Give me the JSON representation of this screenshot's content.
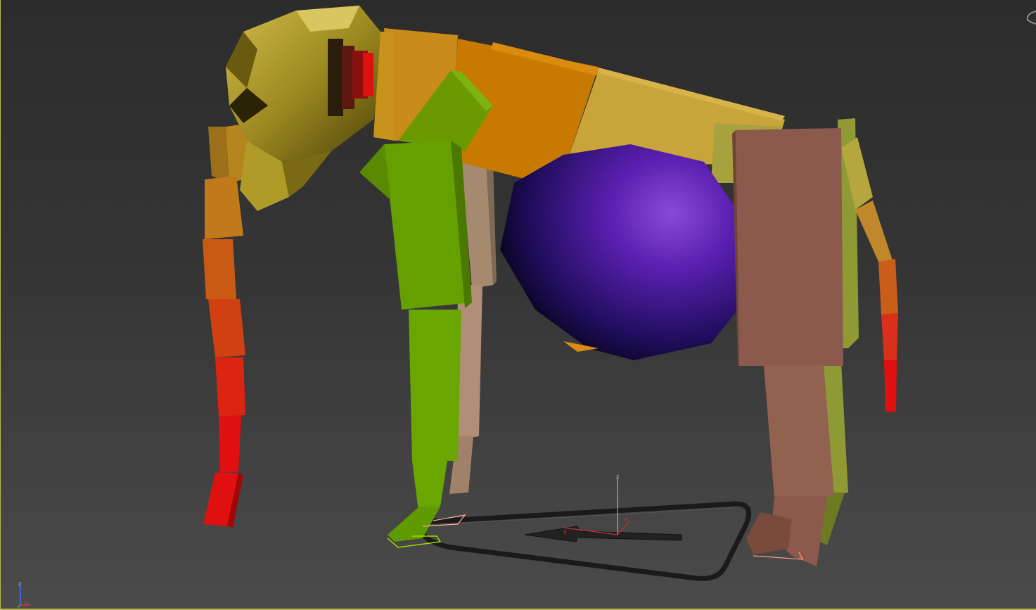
{
  "viewport": {
    "background_top": "#2c2c2c",
    "background_bottom": "#4b4b4b",
    "border_color": "#b9b94a"
  },
  "axis_gizmo": {
    "labels": {
      "z": "z",
      "x": "x"
    },
    "colors": {
      "z": "#4a6cff",
      "x": "#e03030",
      "y": "#30c030"
    }
  },
  "pivot_gizmo": {
    "labels": {
      "z": "z",
      "y": "y",
      "x": "x"
    }
  },
  "icons": {
    "viewcube": "viewcube-icon",
    "axis": "world-axis-icon",
    "pivot": "transform-pivot-icon"
  },
  "model": {
    "name": "",
    "colors": {
      "head": "#b59a26",
      "spine_front": "#c87a00",
      "spine_back": "#c9a43a",
      "arm_left": "#6a9a00",
      "arm_right_back": "#a68a70",
      "leg_back": "#8c5a4c",
      "leg_back_side": "#8f9a34",
      "ball": "#6a2fc4",
      "tail_top": "#b58620",
      "tail_bottom": "#e01010",
      "ground_shape": "#1c1c1c"
    }
  }
}
